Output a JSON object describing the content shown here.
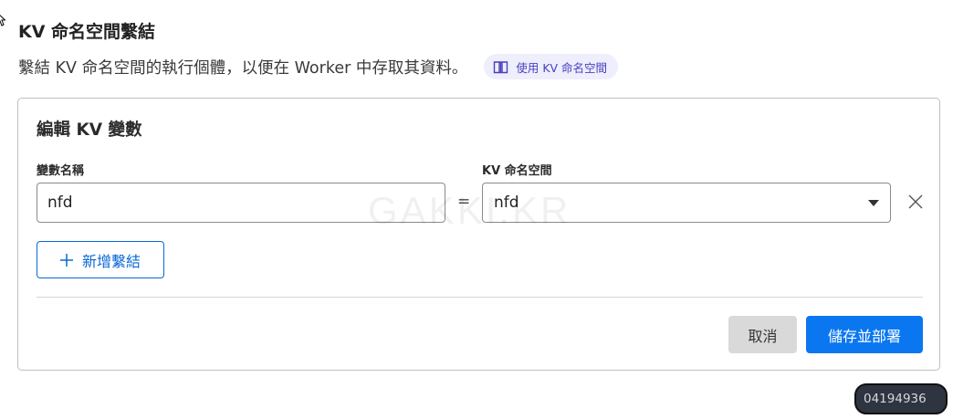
{
  "page": {
    "title": "KV 命名空間繫結",
    "subtitle": "繫結 KV 命名空間的執行個體，以便在 Worker 中存取其資料。",
    "doc_link_label": "使用 KV 命名空間"
  },
  "card": {
    "title": "編輯 KV 變數",
    "variable_label": "變數名稱",
    "namespace_label": "KV 命名空間",
    "variable_value": "nfd",
    "equals": "=",
    "namespace_value": "nfd",
    "add_button_label": "新增繫結",
    "cancel_label": "取消",
    "save_label": "儲存並部署"
  },
  "overlay": {
    "watermark": "GAKKI.KR",
    "id_badge": "04194936"
  },
  "colors": {
    "accent": "#0a77f0",
    "outline_accent": "#0a68d6",
    "doc_link_bg": "#eeeefc",
    "doc_link_text": "#4a3fbf",
    "cancel_bg": "#d9d9d9"
  },
  "icons": {
    "doc_link": "book-icon",
    "namespace_dropdown": "caret-down-icon",
    "remove_row": "close-icon",
    "add": "plus-icon"
  }
}
